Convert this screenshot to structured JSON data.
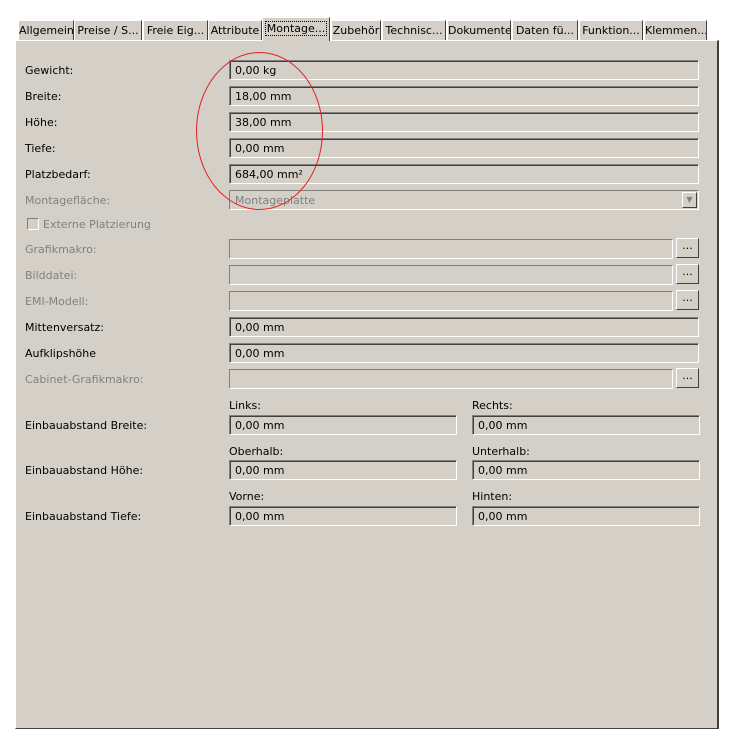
{
  "tabs": [
    {
      "label": "Allgemein"
    },
    {
      "label": "Preise / S..."
    },
    {
      "label": "Freie Eig..."
    },
    {
      "label": "Attribute"
    },
    {
      "label": "Montage..."
    },
    {
      "label": "Zubehör"
    },
    {
      "label": "Technisc..."
    },
    {
      "label": "Dokumente"
    },
    {
      "label": "Daten fü..."
    },
    {
      "label": "Funktion..."
    },
    {
      "label": "Klemmen..."
    }
  ],
  "fields": {
    "gewicht": {
      "label": "Gewicht:",
      "value": "0,00 kg"
    },
    "breite": {
      "label": "Breite:",
      "value": "18,00 mm"
    },
    "hoehe": {
      "label": "Höhe:",
      "value": "38,00 mm"
    },
    "tiefe": {
      "label": "Tiefe:",
      "value": "0,00 mm"
    },
    "platzbedarf": {
      "label": "Platzbedarf:",
      "value": "684,00 mm²"
    },
    "montageflaeche": {
      "label": "Montagefläche:",
      "value": "Montageplatte"
    },
    "externe": {
      "label": "Externe Platzierung"
    },
    "grafikmakro": {
      "label": "Grafikmakro:",
      "value": ""
    },
    "bilddatei": {
      "label": "Bilddatei:",
      "value": ""
    },
    "emi": {
      "label": "EMI-Modell:",
      "value": ""
    },
    "mittenversatz": {
      "label": "Mittenversatz:",
      "value": "0,00 mm"
    },
    "aufklipshoehe": {
      "label": "Aufklipshöhe",
      "value": "0,00 mm"
    },
    "cabinet": {
      "label": "Cabinet-Grafikmakro:",
      "value": ""
    }
  },
  "browse_label": "...",
  "einbau": {
    "breite": {
      "label": "Einbauabstand Breite:",
      "left_label": "Links:",
      "left_value": "0,00 mm",
      "right_label": "Rechts:",
      "right_value": "0,00 mm"
    },
    "hoehe": {
      "label": "Einbauabstand Höhe:",
      "left_label": "Oberhalb:",
      "left_value": "0,00 mm",
      "right_label": "Unterhalb:",
      "right_value": "0,00 mm"
    },
    "tiefe": {
      "label": "Einbauabstand Tiefe:",
      "left_label": "Vorne:",
      "left_value": "0,00 mm",
      "right_label": "Hinten:",
      "right_value": "0,00 mm"
    }
  },
  "colors": {
    "annotation_circle": "#e02020",
    "panel_bg": "#d4d0c8",
    "disabled_text": "#808080"
  }
}
